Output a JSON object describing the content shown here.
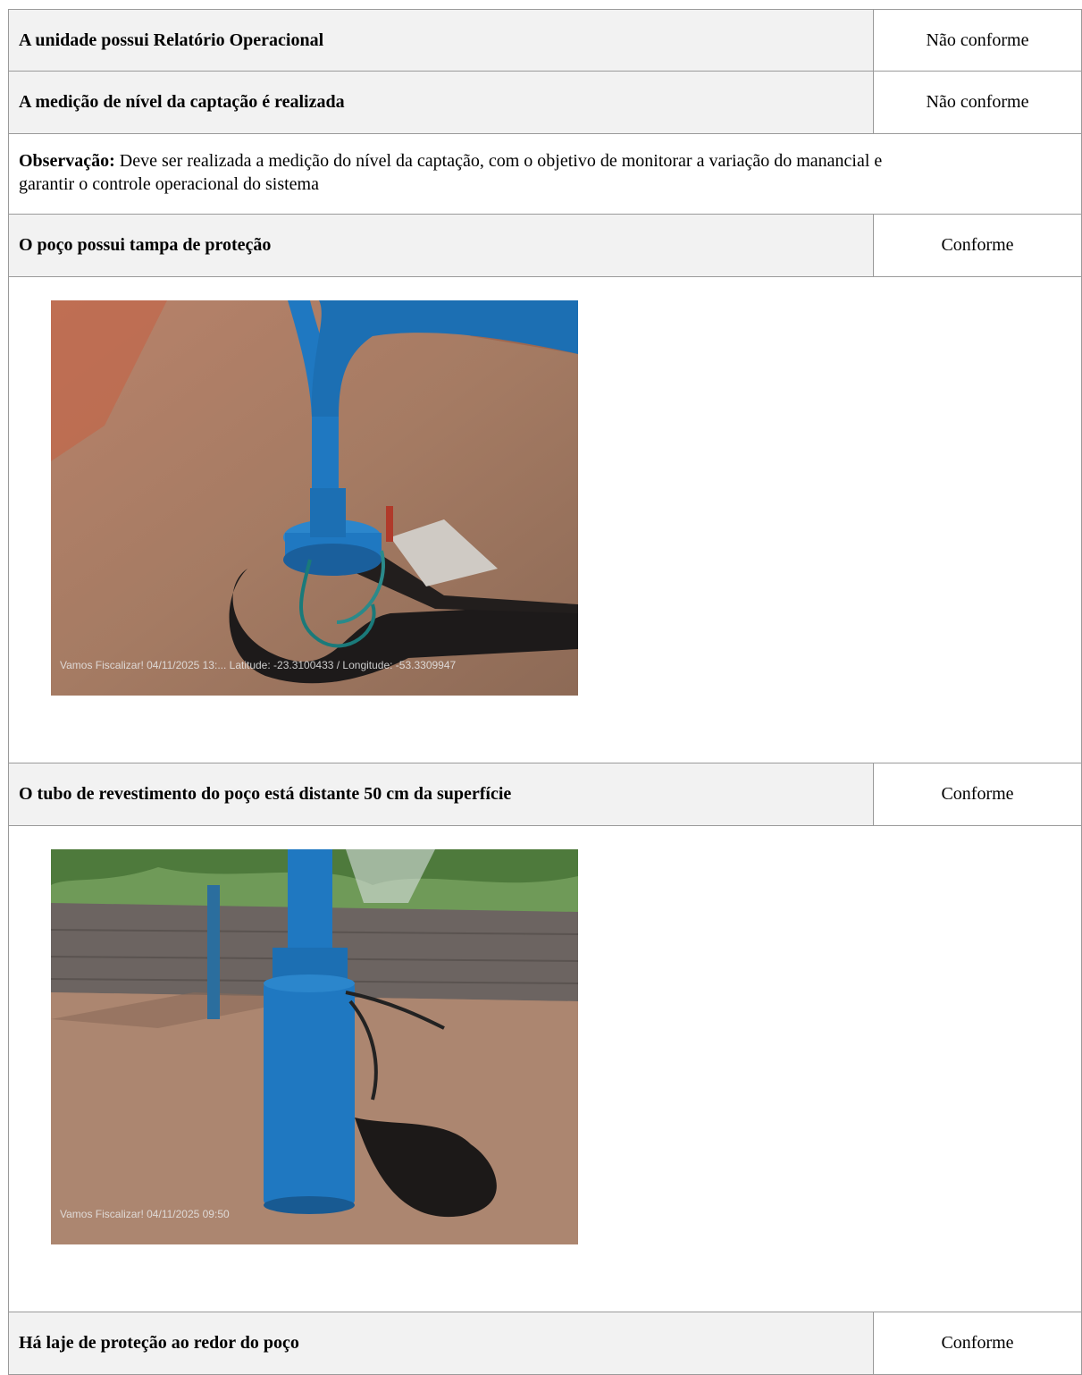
{
  "rows": [
    {
      "question": "A unidade possui Relatório Operacional",
      "status": "Não conforme"
    },
    {
      "question": "A medição de nível da captação é realizada",
      "status": "Não conforme"
    },
    {
      "observation_label": "Observação:",
      "observation_text_line1": " Deve ser realizada a medição do nível da captação, com o objetivo de monitorar a variação do manancial e",
      "observation_text_line2": "garantir o controle operacional do sistema"
    },
    {
      "question": "O poço possui tampa de proteção",
      "status": "Conforme"
    },
    {
      "photo_caption": "Vamos Fiscalizar! 04/11/2025 13:...  Latitude: -23.3100433 / Longitude: -53.3309947"
    },
    {
      "question": "O tubo de revestimento do poço está distante 50 cm da superfície",
      "status": "Conforme"
    },
    {
      "photo_caption": "Vamos Fiscalizar! 04/11/2025 09:50"
    },
    {
      "question": "Há laje de proteção ao redor do poço",
      "status": "Conforme"
    }
  ],
  "colors": {
    "header_bg": "#f2f2f2",
    "border": "#9a9a9a",
    "pipe_blue": "#1f78c1",
    "ground": "#a57b63"
  }
}
